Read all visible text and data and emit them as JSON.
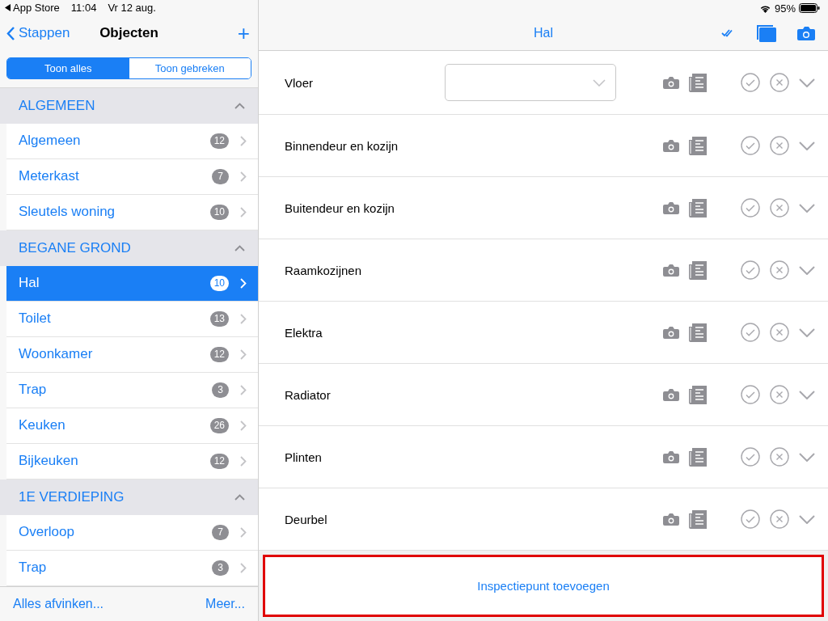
{
  "status_bar": {
    "back_app": "App Store",
    "time": "11:04",
    "date": "Vr 12 aug.",
    "battery": "95%"
  },
  "sidebar": {
    "back": "Stappen",
    "title": "Objecten",
    "add": "+",
    "filter": [
      {
        "label": "Toon alles",
        "selected": true
      },
      {
        "label": "Toon gebreken",
        "selected": false
      }
    ],
    "sections": [
      {
        "title": "ALGEMEEN",
        "expanded": true,
        "items": [
          {
            "label": "Algemeen",
            "count": "12",
            "selected": false
          },
          {
            "label": "Meterkast",
            "count": "7",
            "selected": false
          },
          {
            "label": "Sleutels woning",
            "count": "10",
            "selected": false
          }
        ]
      },
      {
        "title": "BEGANE GROND",
        "expanded": true,
        "items": [
          {
            "label": "Hal",
            "count": "10",
            "selected": true
          },
          {
            "label": "Toilet",
            "count": "13",
            "selected": false
          },
          {
            "label": "Woonkamer",
            "count": "12",
            "selected": false
          },
          {
            "label": "Trap",
            "count": "3",
            "selected": false
          },
          {
            "label": "Keuken",
            "count": "26",
            "selected": false
          },
          {
            "label": "Bijkeuken",
            "count": "12",
            "selected": false
          }
        ]
      },
      {
        "title": "1E VERDIEPING",
        "expanded": true,
        "items": [
          {
            "label": "Overloop",
            "count": "7",
            "selected": false
          },
          {
            "label": "Trap",
            "count": "3",
            "selected": false
          }
        ]
      }
    ],
    "footer": {
      "left": "Alles afvinken...",
      "right": "Meer..."
    }
  },
  "detail": {
    "title": "Hal",
    "rows": [
      {
        "label": "Vloer",
        "kind": "select"
      },
      {
        "label": "Binnendeur en kozijn",
        "kind": "plain"
      },
      {
        "label": "Buitendeur en kozijn",
        "kind": "plain"
      },
      {
        "label": "Raamkozijnen",
        "kind": "plain"
      },
      {
        "label": "Elektra",
        "kind": "plain"
      },
      {
        "label": "Radiator",
        "kind": "plain"
      },
      {
        "label": "Plinten",
        "kind": "plain"
      },
      {
        "label": "Deurbel",
        "kind": "plain"
      }
    ],
    "add_button": {
      "label": "Inspectiepunt toevoegen",
      "highlighted": true
    }
  }
}
